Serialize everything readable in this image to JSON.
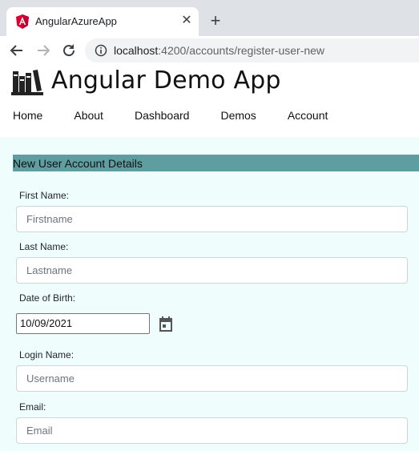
{
  "browser": {
    "tab_title": "AngularAzureApp",
    "url_host": "localhost",
    "url_rest": ":4200/accounts/register-user-new",
    "tab_close_glyph": "✕",
    "new_tab_glyph": "+"
  },
  "app": {
    "title": "Angular Demo App",
    "nav": [
      "Home",
      "About",
      "Dashboard",
      "Demos",
      "Account"
    ]
  },
  "form": {
    "section_title": "New User Account Details",
    "first_name": {
      "label": "First Name:",
      "placeholder": "Firstname"
    },
    "last_name": {
      "label": "Last Name:",
      "placeholder": "Lastname"
    },
    "dob": {
      "label": "Date of Birth:",
      "value": "10/09/2021"
    },
    "login_name": {
      "label": "Login Name:",
      "placeholder": "Username"
    },
    "email": {
      "label": "Email:",
      "placeholder": "Email"
    }
  },
  "colors": {
    "section_bar": "#5f9ea0",
    "content_bg": "#effdfd",
    "angular_red": "#dd0031"
  }
}
